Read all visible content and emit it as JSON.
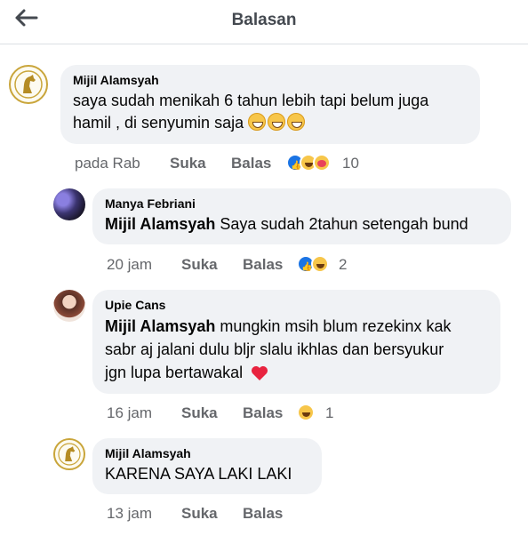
{
  "header": {
    "title": "Balasan"
  },
  "comment": {
    "author": "Mijil Alamsyah",
    "text": "saya sudah menikah 6 tahun lebih tapi belum juga",
    "text2": "hamil , di senyumin saja",
    "time": "pada Rab",
    "like_label": "Suka",
    "reply_label": "Balas",
    "reactions": [
      "like",
      "haha",
      "care"
    ],
    "reaction_count": "10"
  },
  "replies": [
    {
      "author": "Manya Febriani",
      "mention": "Mijil Alamsyah",
      "text": "Saya sudah 2tahun setengah bund",
      "time": "20 jam",
      "like_label": "Suka",
      "reply_label": "Balas",
      "reactions": [
        "like",
        "haha"
      ],
      "reaction_count": "2"
    },
    {
      "author": "Upie Cans",
      "mention": "Mijil Alamsyah",
      "text1": "mungkin msih blum rezekinx kak",
      "text2": "sabr aj jalani dulu bljr slalu ikhlas dan bersyukur",
      "text3": "jgn lupa bertawakal",
      "time": "16 jam",
      "like_label": "Suka",
      "reply_label": "Balas",
      "reactions": [
        "haha"
      ],
      "reaction_count": "1"
    },
    {
      "author": "Mijil Alamsyah",
      "text": "KARENA SAYA LAKI LAKI",
      "time": "13 jam",
      "like_label": "Suka",
      "reply_label": "Balas"
    }
  ],
  "colors": {
    "bubble": "#f0f2f5",
    "meta": "#65676b",
    "like_blue": "#1b74e4",
    "heart": "#e8233f"
  }
}
